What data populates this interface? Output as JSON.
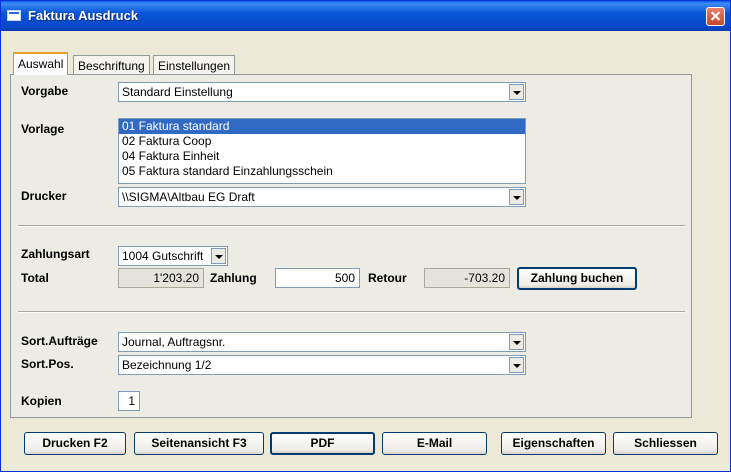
{
  "window": {
    "title": "Faktura Ausdruck"
  },
  "tabs": [
    {
      "label": "Auswahl"
    },
    {
      "label": "Beschriftung"
    },
    {
      "label": "Einstellungen"
    }
  ],
  "form": {
    "vorgabe": {
      "label": "Vorgabe",
      "value": "Standard Einstellung"
    },
    "vorlage": {
      "label": "Vorlage",
      "items": [
        "01 Faktura standard",
        "02 Faktura Coop",
        "04 Faktura Einheit",
        "05 Faktura standard Einzahlungsschein"
      ],
      "selected_index": 0
    },
    "drucker": {
      "label": "Drucker",
      "value": "\\\\SIGMA\\Altbau EG Draft"
    },
    "zahlungsart": {
      "label": "Zahlungsart",
      "value": "1004  Gutschrift"
    },
    "total": {
      "label": "Total",
      "value": "1'203.20"
    },
    "zahlung": {
      "label": "Zahlung",
      "value": "500"
    },
    "retour": {
      "label": "Retour",
      "value": "-703.20"
    },
    "zahlung_buchen_label": "Zahlung buchen",
    "sort_auftraege": {
      "label": "Sort.Aufträge",
      "value": "Journal, Auftragsnr."
    },
    "sort_pos": {
      "label": "Sort.Pos.",
      "value": "Bezeichnung 1/2"
    },
    "kopien": {
      "label": "Kopien",
      "value": "1"
    }
  },
  "footer_buttons": [
    {
      "label": "Drucken F2"
    },
    {
      "label": "Seitenansicht F3"
    },
    {
      "label": "PDF"
    },
    {
      "label": "E-Mail"
    },
    {
      "label": "Eigenschaften"
    },
    {
      "label": "Schliessen"
    }
  ]
}
